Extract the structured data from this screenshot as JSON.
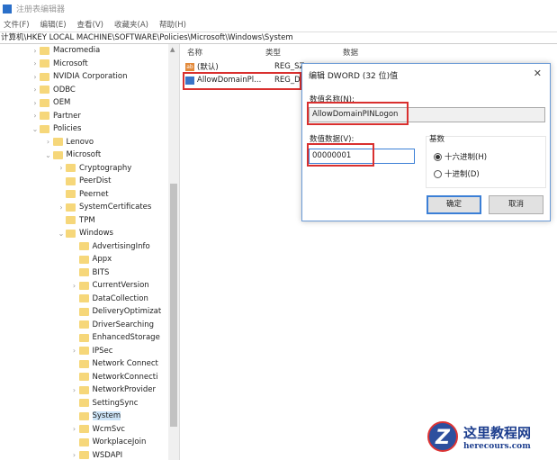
{
  "window": {
    "title": "注册表编辑器"
  },
  "menu": [
    "文件(F)",
    "编辑(E)",
    "查看(V)",
    "收藏夹(A)",
    "帮助(H)"
  ],
  "address": "计算机\\HKEY LOCAL MACHINE\\SOFTWARE\\Policies\\Microsoft\\Windows\\System",
  "tree": [
    {
      "label": "Macromedia",
      "level": 1,
      "state": "collapsed"
    },
    {
      "label": "Microsoft",
      "level": 1,
      "state": "collapsed"
    },
    {
      "label": "NVIDIA Corporation",
      "level": 1,
      "state": "collapsed"
    },
    {
      "label": "ODBC",
      "level": 1,
      "state": "collapsed"
    },
    {
      "label": "OEM",
      "level": 1,
      "state": "collapsed"
    },
    {
      "label": "Partner",
      "level": 1,
      "state": "collapsed"
    },
    {
      "label": "Policies",
      "level": 1,
      "state": "expanded"
    },
    {
      "label": "Lenovo",
      "level": 2,
      "state": "collapsed"
    },
    {
      "label": "Microsoft",
      "level": 2,
      "state": "expanded"
    },
    {
      "label": "Cryptography",
      "level": 3,
      "state": "collapsed"
    },
    {
      "label": "PeerDist",
      "level": 3,
      "state": "none"
    },
    {
      "label": "Peernet",
      "level": 3,
      "state": "none"
    },
    {
      "label": "SystemCertificates",
      "level": 3,
      "state": "collapsed"
    },
    {
      "label": "TPM",
      "level": 3,
      "state": "none"
    },
    {
      "label": "Windows",
      "level": 3,
      "state": "expanded"
    },
    {
      "label": "AdvertisingInfo",
      "level": 4,
      "state": "none"
    },
    {
      "label": "Appx",
      "level": 4,
      "state": "none"
    },
    {
      "label": "BITS",
      "level": 4,
      "state": "none"
    },
    {
      "label": "CurrentVersion",
      "level": 4,
      "state": "collapsed"
    },
    {
      "label": "DataCollection",
      "level": 4,
      "state": "none"
    },
    {
      "label": "DeliveryOptimizat",
      "level": 4,
      "state": "none"
    },
    {
      "label": "DriverSearching",
      "level": 4,
      "state": "none"
    },
    {
      "label": "EnhancedStorage",
      "level": 4,
      "state": "none"
    },
    {
      "label": "IPSec",
      "level": 4,
      "state": "collapsed"
    },
    {
      "label": "Network Connect",
      "level": 4,
      "state": "none"
    },
    {
      "label": "NetworkConnecti",
      "level": 4,
      "state": "none"
    },
    {
      "label": "NetworkProvider",
      "level": 4,
      "state": "collapsed"
    },
    {
      "label": "SettingSync",
      "level": 4,
      "state": "none"
    },
    {
      "label": "System",
      "level": 4,
      "state": "selected"
    },
    {
      "label": "WcmSvc",
      "level": 4,
      "state": "collapsed"
    },
    {
      "label": "WorkplaceJoin",
      "level": 4,
      "state": "none"
    },
    {
      "label": "WSDAPI",
      "level": 4,
      "state": "collapsed"
    }
  ],
  "list": {
    "headers": [
      "名称",
      "类型",
      "数据"
    ],
    "rows": [
      {
        "name": "(默认)",
        "type": "REG_SZ",
        "icon": "string-value-icon"
      },
      {
        "name": "AllowDomainPl...",
        "type": "REG_DW",
        "icon": "dword-value-icon"
      }
    ]
  },
  "dialog": {
    "title": "编辑 DWORD (32 位)值",
    "close": "✕",
    "name_label": "数值名称(N):",
    "name_value": "AllowDomainPINLogon",
    "data_label": "数值数据(V):",
    "data_value": "00000001",
    "base_label": "基数",
    "radio_hex": "十六进制(H)",
    "radio_dec": "十进制(D)",
    "ok": "确定",
    "cancel": "取消"
  },
  "watermark": {
    "cn": "这里教程网",
    "en": "herecours.com"
  },
  "colors": {
    "highlight": "#d9302f",
    "selection": "#cce4f7",
    "accent": "#3b7fd6"
  }
}
